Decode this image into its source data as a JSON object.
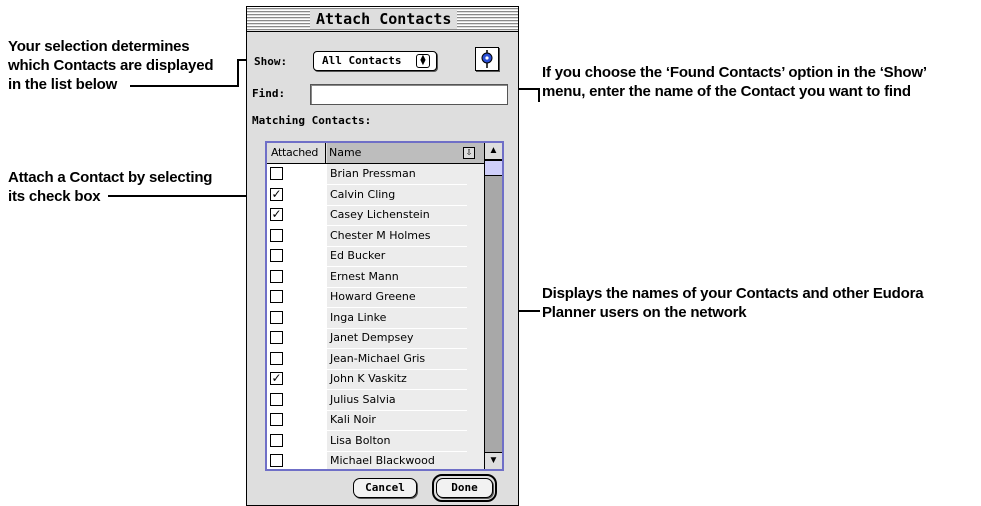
{
  "window": {
    "title": "Attach Contacts"
  },
  "show": {
    "label": "Show:",
    "value": "All Contacts"
  },
  "find": {
    "label": "Find:",
    "value": ""
  },
  "matching_label": "Matching Contacts:",
  "list": {
    "columns": [
      "Attached",
      "Name"
    ],
    "rows": [
      {
        "name": "Brian Pressman",
        "attached": false
      },
      {
        "name": "Calvin Cling",
        "attached": true
      },
      {
        "name": "Casey Lichenstein",
        "attached": true
      },
      {
        "name": "Chester M Holmes",
        "attached": false
      },
      {
        "name": "Ed Bucker",
        "attached": false
      },
      {
        "name": "Ernest Mann",
        "attached": false
      },
      {
        "name": "Howard Greene",
        "attached": false
      },
      {
        "name": "Inga Linke",
        "attached": false
      },
      {
        "name": "Janet Dempsey",
        "attached": false
      },
      {
        "name": "Jean-Michael Gris",
        "attached": false
      },
      {
        "name": "John K Vaskitz",
        "attached": true
      },
      {
        "name": "Julius Salvia",
        "attached": false
      },
      {
        "name": "Kali Noir",
        "attached": false
      },
      {
        "name": "Lisa Bolton",
        "attached": false
      },
      {
        "name": "Michael Blackwood",
        "attached": false
      }
    ]
  },
  "buttons": {
    "cancel": "Cancel",
    "done": "Done"
  },
  "callouts": {
    "selection": [
      "Your selection determines",
      "which Contacts are displayed",
      "in the list below"
    ],
    "find": [
      "If you choose the ‘Found Contacts’ option in the ‘Show’",
      "menu, enter the name of the Contact you want to find"
    ],
    "attach": [
      "Attach a Contact by selecting",
      "its check box"
    ],
    "names": [
      "Displays the names of your Contacts and other Eudora",
      "Planner users on the network"
    ]
  },
  "colors": {
    "list_border": "#6f6fc7",
    "scroll_thumb": "#cfcffa",
    "help_icon": "#2a4fd6"
  }
}
